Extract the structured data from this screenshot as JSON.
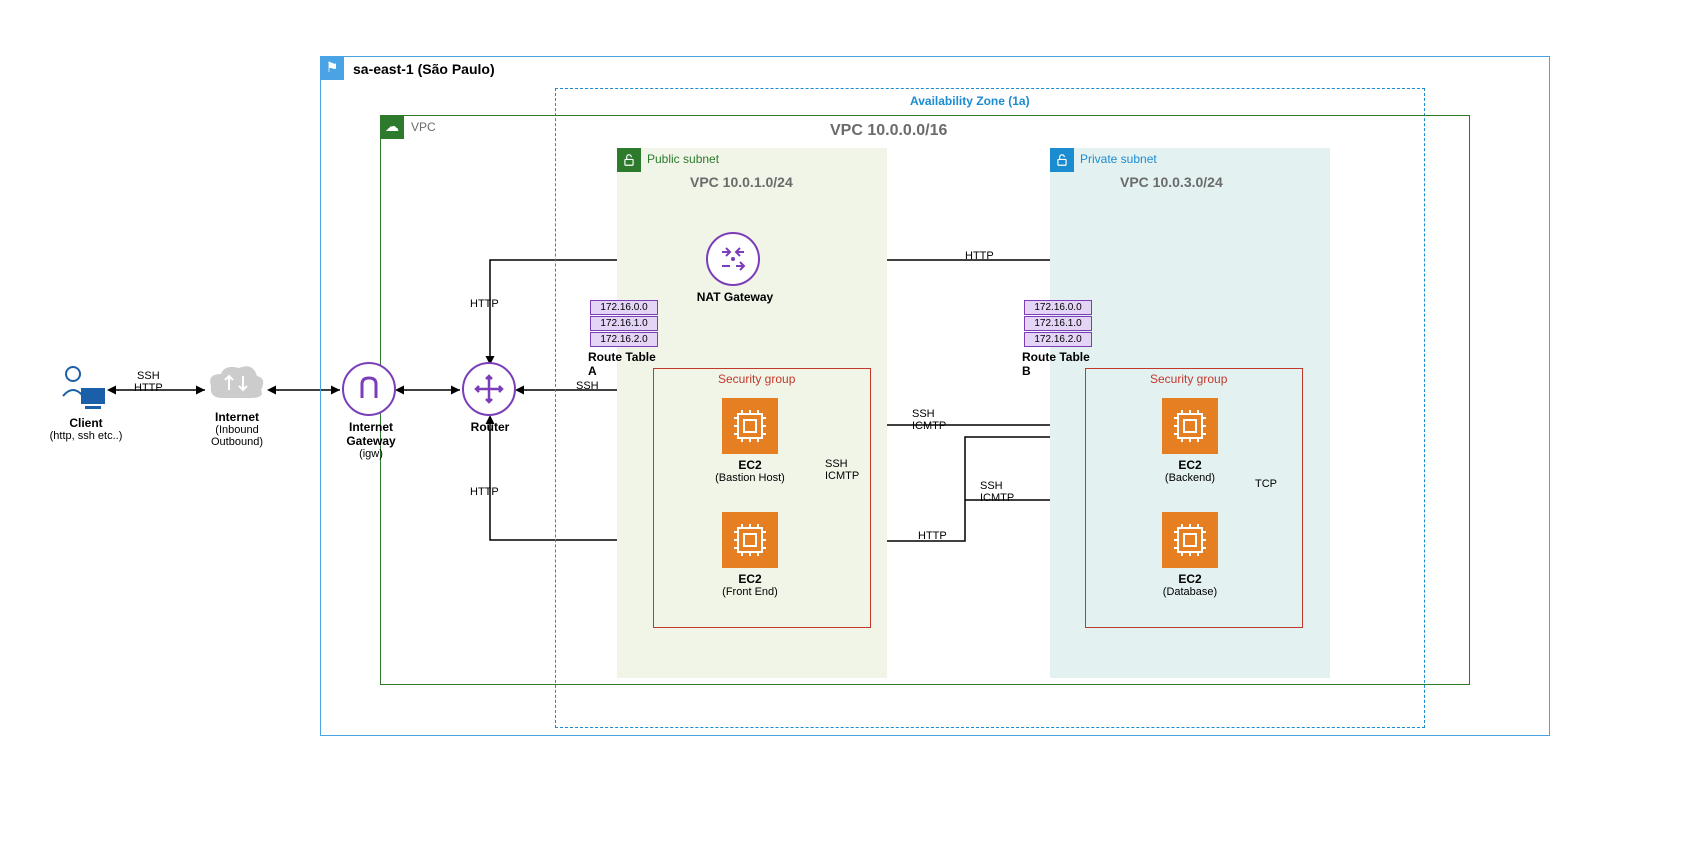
{
  "region": {
    "name": "sa-east-1 (São Paulo)"
  },
  "vpc": {
    "label": "VPC",
    "cidr_title": "VPC 10.0.0.0/16"
  },
  "az": {
    "label": "Availability Zone (1a)"
  },
  "public_subnet": {
    "label": "Public subnet",
    "cidr": "VPC 10.0.1.0/24",
    "sg_label": "Security group"
  },
  "private_subnet": {
    "label": "Private subnet",
    "cidr": "VPC 10.0.3.0/24",
    "sg_label": "Security group"
  },
  "route_table_a": {
    "label": "Route Table A",
    "entries": [
      "172.16.0.0",
      "172.16.1.0",
      "172.16.2.0"
    ]
  },
  "route_table_b": {
    "label": "Route Table B",
    "entries": [
      "172.16.0.0",
      "172.16.1.0",
      "172.16.2.0"
    ]
  },
  "nodes": {
    "client": {
      "line1": "Client",
      "line2": "(http, ssh etc..)"
    },
    "internet": {
      "line1": "Internet",
      "line2": "(Inbound",
      "line3": "Outbound)"
    },
    "igw": {
      "line1": "Internet",
      "line2": "Gateway",
      "line3": "(igw)"
    },
    "router": {
      "line1": "Router"
    },
    "nat": {
      "line1": "NAT Gateway"
    },
    "ec2_bastion": {
      "line1": "EC2",
      "line2": "(Bastion Host)"
    },
    "ec2_frontend": {
      "line1": "EC2",
      "line2": "(Front End)"
    },
    "ec2_backend": {
      "line1": "EC2",
      "line2": "(Backend)"
    },
    "ec2_database": {
      "line1": "EC2",
      "line2": "(Database)"
    }
  },
  "edges": {
    "client_internet": "SSH\nHTTP",
    "router_http_top": "HTTP",
    "router_ssh": "SSH",
    "router_http_bot": "HTTP",
    "nat_backend": "HTTP",
    "bastion_backend": "SSH\nICMTP",
    "bastion_frontend": "SSH\nICMTP",
    "frontend_backend": "HTTP",
    "frontend_backend_ssh": "SSH\nICMTP",
    "backend_db": "TCP"
  }
}
